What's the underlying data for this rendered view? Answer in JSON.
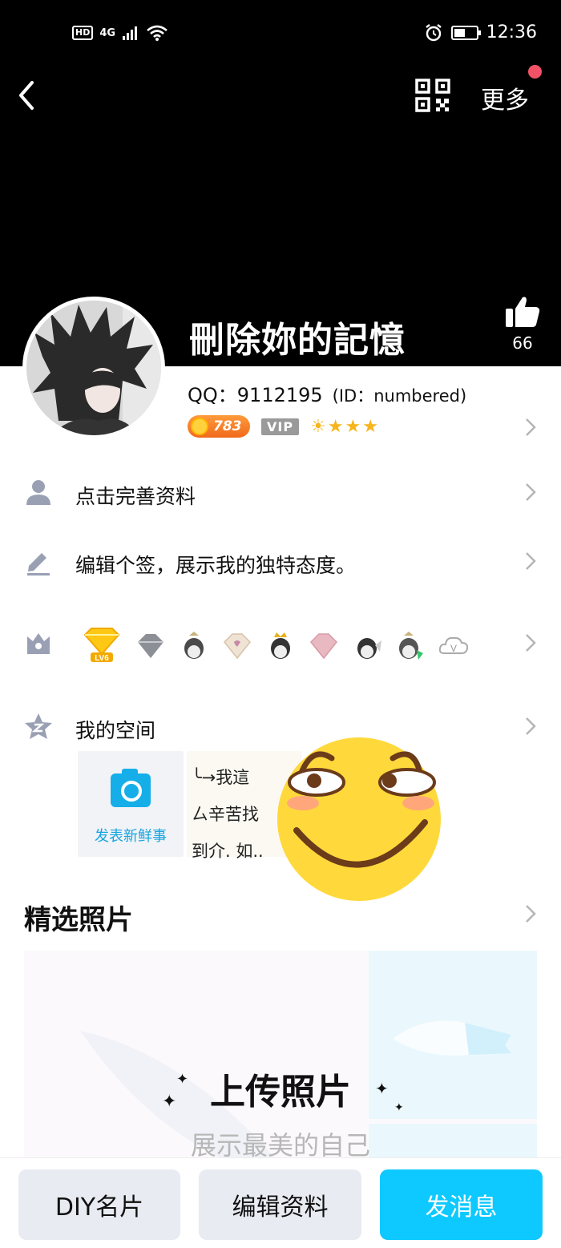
{
  "status_bar": {
    "hd": "HD",
    "network": "4G",
    "time": "12:36"
  },
  "header": {
    "more_label": "更多",
    "nickname": "刪除妳的記憶",
    "like_count": "66"
  },
  "profile": {
    "qq_label": "QQ：",
    "qq_number": "9112195",
    "id_text": "(ID：numbered)",
    "coin_value": "783",
    "vip_label": "VIP",
    "star_glyphs": [
      "☀",
      "★",
      "★",
      "★"
    ]
  },
  "menu": {
    "complete_profile": "点击完善资料",
    "edit_signature": "编辑个签，展示我的独特态度。",
    "my_space": "我的空间"
  },
  "space": {
    "post_label": "发表新鲜事",
    "snippet_lines": [
      "╰→我這",
      "ㄙ辛苦找",
      "到介. 如.."
    ]
  },
  "photos": {
    "section_title": "精选照片",
    "upload_title": "上传照片",
    "upload_subtitle": "展示最美的自己"
  },
  "bottom_bar": {
    "diy_card": "DIY名片",
    "edit_profile": "编辑资料",
    "send_message": "发消息"
  },
  "colors": {
    "accent": "#0EC9FF",
    "notify_dot": "#F25266",
    "link_blue": "#17A4E0"
  }
}
